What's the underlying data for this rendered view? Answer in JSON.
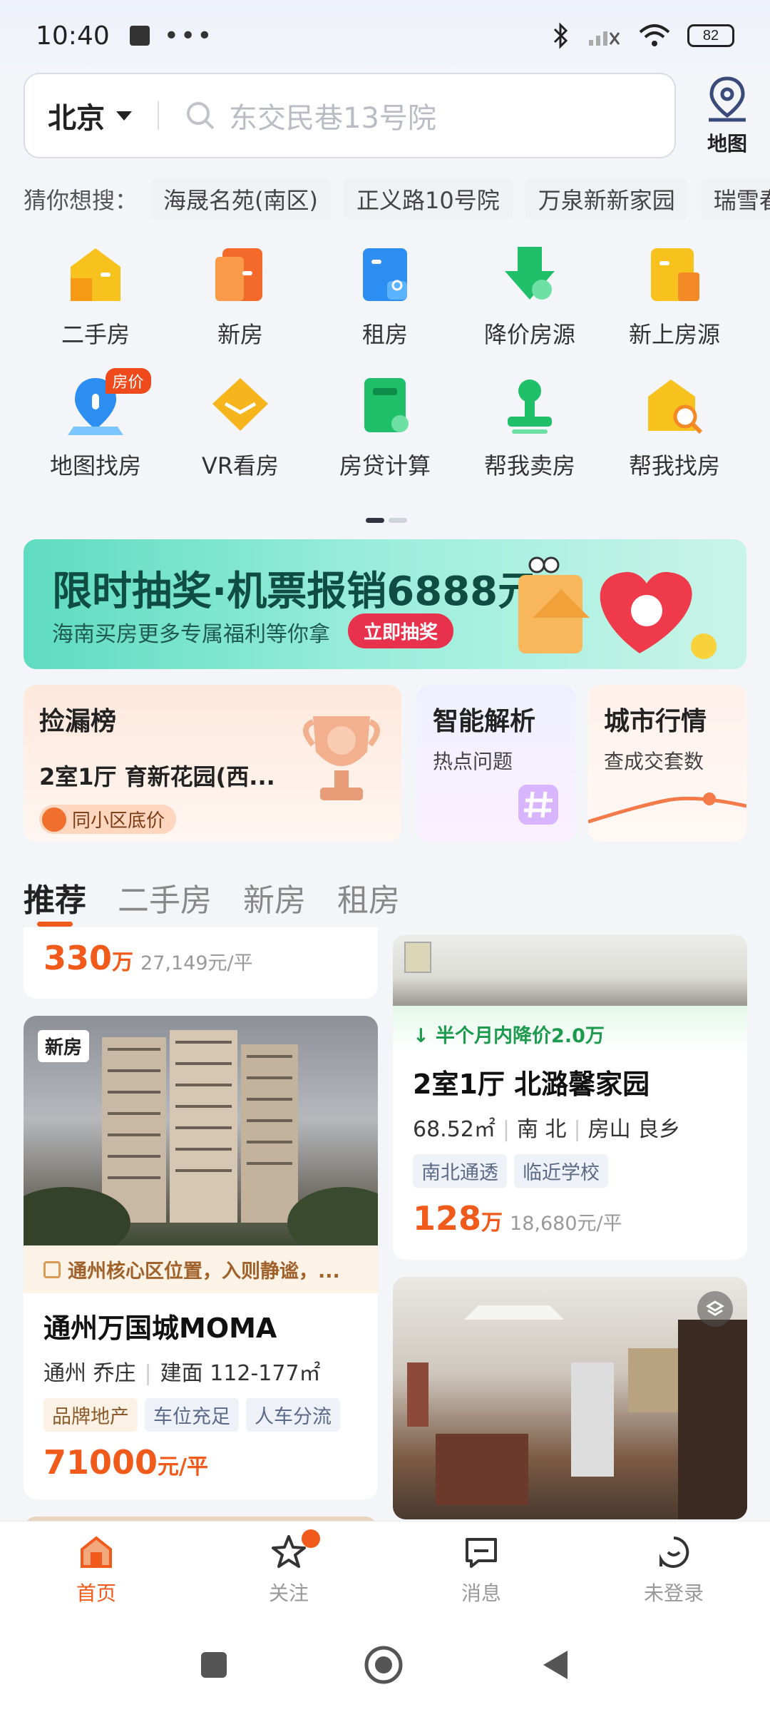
{
  "status": {
    "time": "10:40",
    "dots": "•••",
    "battery": "82"
  },
  "search": {
    "city": "北京",
    "placeholder": "东交民巷13号院"
  },
  "map_button": {
    "label": "地图"
  },
  "guess": {
    "label": "猜你想搜：",
    "items": [
      "海晟名苑(南区)",
      "正义路10号院",
      "万泉新新家园",
      "瑞雪春"
    ]
  },
  "quick": [
    {
      "label": "二手房",
      "icon": "house-icon",
      "color": "#f7c21d"
    },
    {
      "label": "新房",
      "icon": "building-icon",
      "color": "#f46a2a"
    },
    {
      "label": "租房",
      "icon": "rent-icon",
      "color": "#2d8ef2"
    },
    {
      "label": "降价房源",
      "icon": "price-down-icon",
      "color": "#20c06a"
    },
    {
      "label": "新上房源",
      "icon": "new-listing-icon",
      "color": "#f7b51d"
    },
    {
      "label": "地图找房",
      "icon": "map-pin-icon",
      "color": "#2d8ef2",
      "badge": "房价"
    },
    {
      "label": "VR看房",
      "icon": "vr-icon",
      "color": "#f7b51d"
    },
    {
      "label": "房贷计算",
      "icon": "calculator-icon",
      "color": "#20c06a"
    },
    {
      "label": "帮我卖房",
      "icon": "stamp-icon",
      "color": "#20c06a"
    },
    {
      "label": "帮我找房",
      "icon": "house-search-icon",
      "color": "#f7c21d"
    }
  ],
  "banner": {
    "title": "限时抽奖·机票报销6888元",
    "subtitle": "海南买房更多专属福利等你拿",
    "button": "立即抽奖"
  },
  "cards": {
    "deal": {
      "title": "捡漏榜",
      "text": "2室1厅 育新花园(西...",
      "tag": "同小区底价"
    },
    "analysis": {
      "title": "智能解析",
      "sub": "热点问题"
    },
    "market": {
      "title": "城市行情",
      "sub": "查成交套数"
    }
  },
  "tabs": [
    "推荐",
    "二手房",
    "新房",
    "租房"
  ],
  "listings": {
    "top_left": {
      "price": "330",
      "unit": "万",
      "per": "27,149元/平"
    },
    "new_home": {
      "badge": "新房",
      "highlight": "通州核心区位置，入则静谧，...",
      "title": "通州万国城MOMA",
      "meta_area": "通州 乔庄",
      "meta_size": "建面 112-177㎡",
      "chips": [
        "品牌地产",
        "车位充足",
        "人车分流"
      ],
      "price": "71000",
      "unit": "元/平"
    },
    "second_hand": {
      "drop": "半个月内降价2.0万",
      "title": "2室1厅 北潞馨家园",
      "meta_size": "68.52㎡",
      "meta_dir": "南 北",
      "meta_area": "房山 良乡",
      "chips": [
        "南北通透",
        "临近学校"
      ],
      "price": "128",
      "unit": "万",
      "per": "18,680元/平"
    }
  },
  "bottom_nav": [
    {
      "label": "首页",
      "icon": "home-icon",
      "active": true
    },
    {
      "label": "关注",
      "icon": "star-icon",
      "active": false
    },
    {
      "label": "消息",
      "icon": "message-icon",
      "active": false
    },
    {
      "label": "未登录",
      "icon": "profile-icon",
      "active": false
    }
  ]
}
